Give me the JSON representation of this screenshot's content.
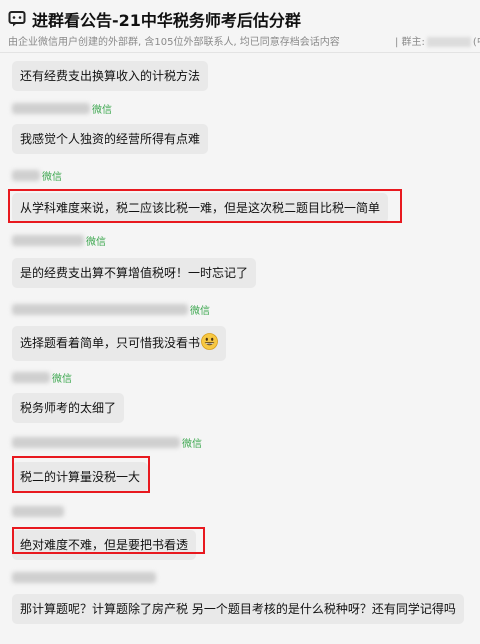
{
  "header": {
    "title": "进群看公告-21中华税务师考后估分群",
    "subtitle": "由企业微信用户创建的外部群, 含105位外部联系人, 均已同意存档会话内容",
    "owner_label": "| 群主:",
    "owner_suffix": "(中"
  },
  "wechat_tag": "微信",
  "messages": [
    {
      "text": "还有经费支出换算收入的计税方法"
    },
    {
      "text": "我感觉个人独资的经营所得有点难"
    },
    {
      "text": "从学科难度来说，税二应该比税一难，但是这次税二题目比税一简单",
      "highlighted": true
    },
    {
      "text": "是的经费支出算不算增值税呀！一时忘记了"
    },
    {
      "text": "选择题看着简单，只可惜我没看书",
      "emoji": "grinning-face"
    },
    {
      "text": "税务师考的太细了"
    },
    {
      "text": "税二的计算量没税一大",
      "highlighted": true
    },
    {
      "text": "绝对难度不难，但是要把书看透",
      "highlighted": true
    },
    {
      "text": "那计算题呢？计算题除了房产税 另一个题目考核的是什么税种呀？还有同学记得吗"
    }
  ],
  "colors": {
    "highlight": "#e8191f",
    "bubble": "#e9e9e9",
    "wechat_tag": "#3aa64d"
  }
}
